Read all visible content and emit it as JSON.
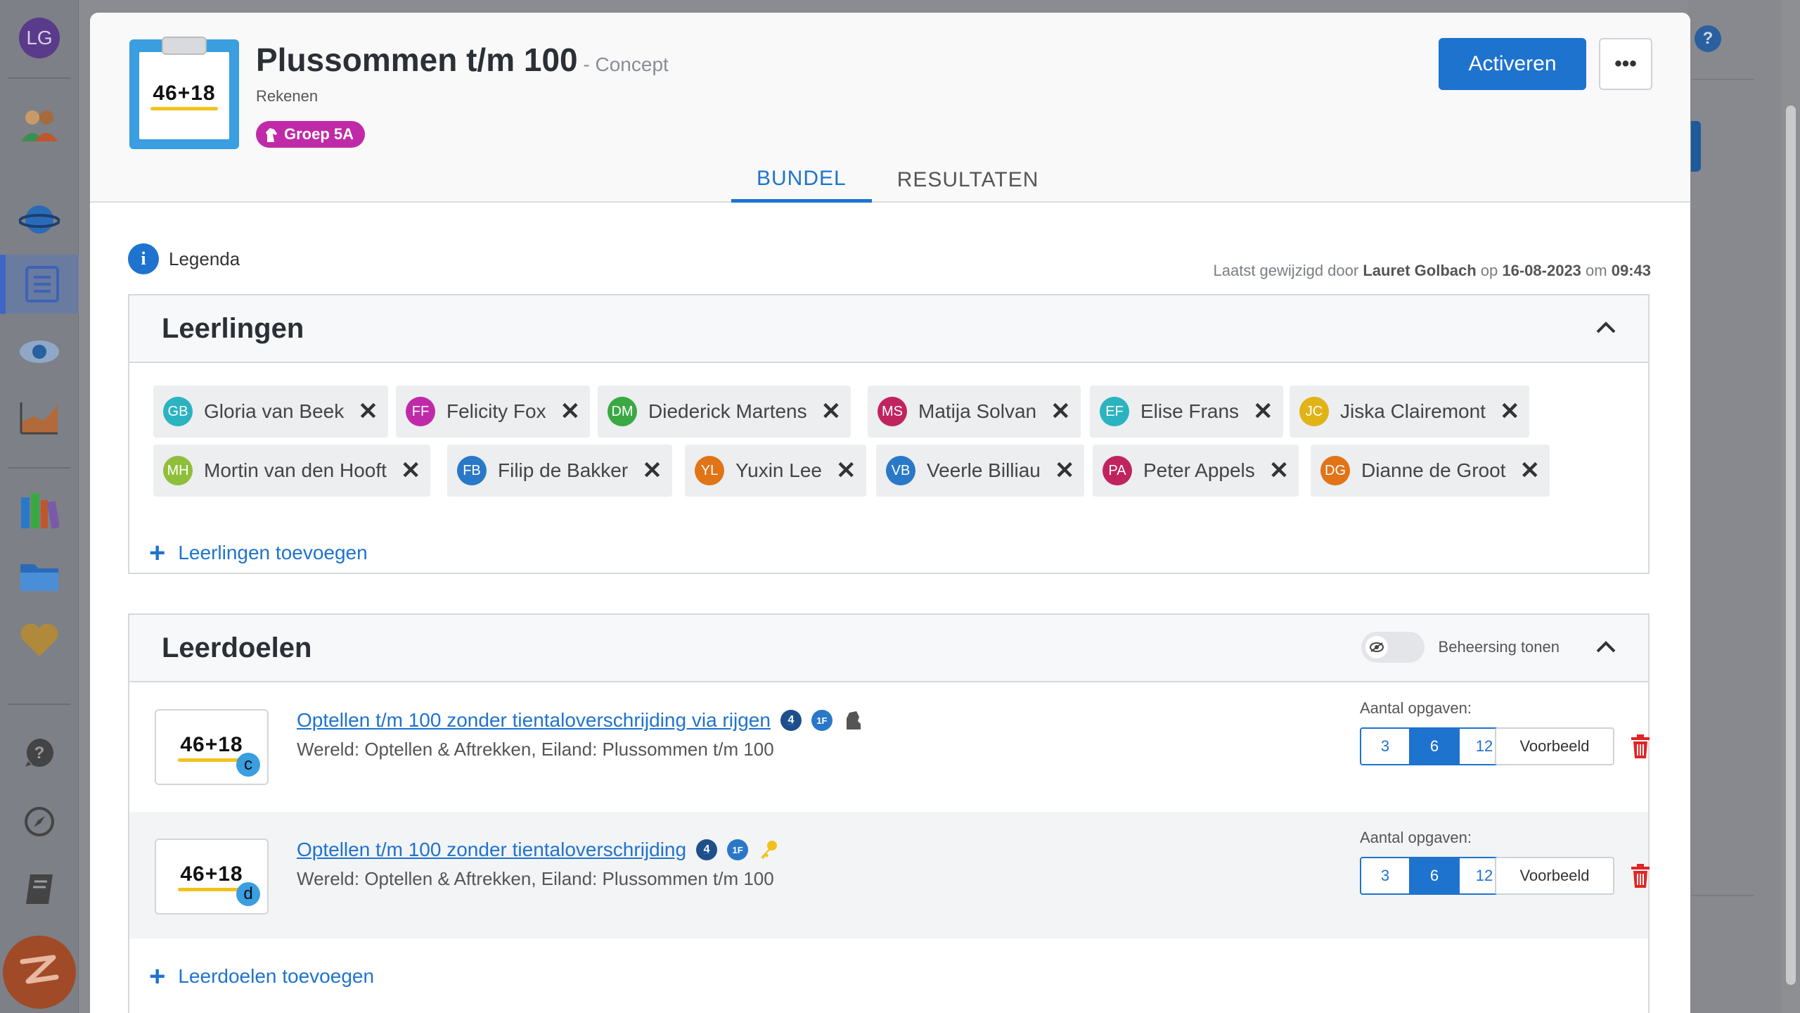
{
  "sidebar": {
    "avatar_initials": "LG",
    "icons": [
      "users-icon",
      "planet-icon",
      "list-icon",
      "eye-icon",
      "chart-icon",
      "books-icon",
      "folder-icon",
      "heart-icon",
      "help-icon",
      "compass-icon",
      "book-icon"
    ]
  },
  "header": {
    "title": "Plussommen t/m 100",
    "status": " - Concept",
    "subject": "Rekenen",
    "group_badge": "Groep 5A",
    "thumb_sum": "46+18",
    "activate_label": "Activeren",
    "more_label": "•••",
    "tabs": [
      {
        "label": "BUNDEL",
        "active": true
      },
      {
        "label": "RESULTATEN",
        "active": false
      }
    ]
  },
  "legend": {
    "label": "Legenda",
    "last_edit_prefix": "Laatst gewijzigd door ",
    "last_edit_user": "Lauret Golbach",
    "last_edit_mid": " op ",
    "last_edit_date": "16-08-2023",
    "last_edit_mid2": " om ",
    "last_edit_time": "09:43"
  },
  "students": {
    "title": "Leerlingen",
    "add_label": "Leerlingen toevoegen",
    "list": [
      {
        "initials": "GB",
        "name": "Gloria van Beek",
        "color": "#2bb3c0"
      },
      {
        "initials": "FF",
        "name": "Felicity Fox",
        "color": "#c02aa8"
      },
      {
        "initials": "DM",
        "name": "Diederick Martens",
        "color": "#3aa843"
      },
      {
        "initials": "MS",
        "name": "Matija Solvan",
        "color": "#c0245e"
      },
      {
        "initials": "EF",
        "name": "Elise Frans",
        "color": "#2bb3c0"
      },
      {
        "initials": "JC",
        "name": "Jiska Clairemont",
        "color": "#e0b316"
      },
      {
        "initials": "MH",
        "name": "Mortin van den Hooft",
        "color": "#8fbf3a"
      },
      {
        "initials": "FB",
        "name": "Filip de Bakker",
        "color": "#2a78c8"
      },
      {
        "initials": "YL",
        "name": "Yuxin Lee",
        "color": "#e07416"
      },
      {
        "initials": "VB",
        "name": "Veerle Billiau",
        "color": "#2a78c8"
      },
      {
        "initials": "PA",
        "name": "Peter Appels",
        "color": "#c0245e"
      },
      {
        "initials": "DG",
        "name": "Dianne de Groot",
        "color": "#e07416"
      }
    ]
  },
  "goals": {
    "title": "Leerdoelen",
    "toggle_label": "Beheersing tonen",
    "add_label": "Leerdoelen toevoegen",
    "count_label": "Aantal opgaven:",
    "preview_label": "Voorbeeld",
    "items": [
      {
        "title": "Optellen t/m 100 zonder tientaloverschrijding via rijgen",
        "subtitle": "Wereld: Optellen & Aftrekken, Eiland: Plussommen t/m 100",
        "level": "c",
        "sum": "46+18",
        "badge1": "4",
        "badge2": "1F",
        "extra_icon": "hand-icon",
        "counts": [
          "3",
          "6",
          "12"
        ],
        "selected": "6"
      },
      {
        "title": "Optellen t/m 100 zonder tientaloverschrijding",
        "subtitle": "Wereld: Optellen & Aftrekken, Eiland: Plussommen t/m 100",
        "level": "d",
        "sum": "46+18",
        "badge1": "4",
        "badge2": "1F",
        "extra_icon": "key-icon",
        "counts": [
          "3",
          "6",
          "12"
        ],
        "selected": "6"
      }
    ]
  }
}
